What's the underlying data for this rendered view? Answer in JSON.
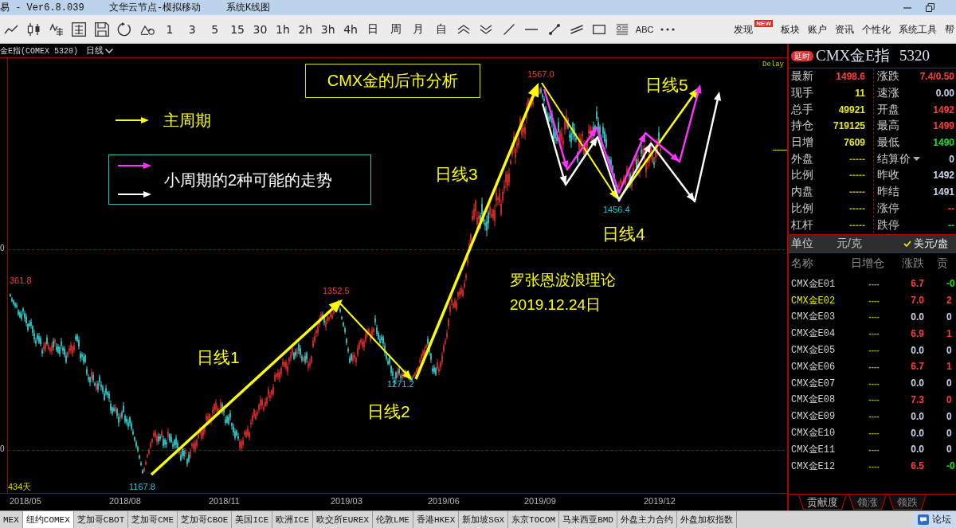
{
  "title_bar": {
    "app_version": "易 - Ver6.8.039",
    "server": "文华云节点-模拟移动",
    "window_title": "系统K线图"
  },
  "toolbar": {
    "periods": [
      "1",
      "3",
      "5",
      "15",
      "30",
      "1h",
      "2h",
      "3h",
      "4h",
      "日",
      "周",
      "月",
      "自"
    ],
    "text_tool": "ABC",
    "menu": [
      {
        "label": "发现",
        "badge": "NEW"
      },
      {
        "label": "板块"
      },
      {
        "label": "账户"
      },
      {
        "label": "资讯"
      },
      {
        "label": "个性化"
      },
      {
        "label": "系统工具"
      },
      {
        "label": "帮"
      }
    ]
  },
  "chart": {
    "symbol": "金E指(COMEX 5320)",
    "period": "日线",
    "delay": "Delay",
    "y_axis_labels": [
      "0",
      "0"
    ],
    "title": "CMX金的后市分析",
    "legend": {
      "main": {
        "label": "主周期",
        "color": "#ffff00"
      },
      "minor": {
        "label": "小周期的2种可能的走势",
        "arrows": [
          {
            "color": "#ff33ff"
          },
          {
            "color": "#ffffff"
          }
        ]
      }
    },
    "wave_labels": [
      "日线1",
      "日线2",
      "日线3",
      "日线4",
      "日线5"
    ],
    "notes": [
      "罗张恩波浪理论",
      "2019.12.24日"
    ],
    "price_labels": [
      {
        "text": "361.8",
        "kind": "high"
      },
      {
        "text": "1352.5",
        "kind": "high"
      },
      {
        "text": "1271.2",
        "kind": "low"
      },
      {
        "text": "1167.8",
        "kind": "low"
      },
      {
        "text": "1567.0",
        "kind": "high"
      },
      {
        "text": "1456.4",
        "kind": "low"
      }
    ],
    "day_count": "434天",
    "x_axis_labels": [
      "2018/05",
      "2018/08",
      "2018/11",
      "2019/03",
      "2019/06",
      "2019/09",
      "2019/12"
    ]
  },
  "quote_panel": {
    "badge": "延时",
    "name": "CMX金E指",
    "code": "5320",
    "left": [
      {
        "label": "最新",
        "value": "1498.6",
        "color": "#ff3b3b"
      },
      {
        "label": "现手",
        "value": "11",
        "color": "#e8e820"
      },
      {
        "label": "总手",
        "value": "49921",
        "color": "#e8e820"
      },
      {
        "label": "持仓",
        "value": "719125",
        "color": "#e8e820"
      },
      {
        "label": "日增",
        "value": "7609",
        "color": "#e8e820"
      },
      {
        "label": "外盘",
        "value": "-----",
        "color": "#b4b400"
      },
      {
        "label": "比例",
        "value": "-----",
        "color": "#b4b400"
      },
      {
        "label": "内盘",
        "value": "-----",
        "color": "#b4b400"
      },
      {
        "label": "比例",
        "value": "-----",
        "color": "#b4b400"
      },
      {
        "label": "杠杆",
        "value": "-----",
        "color": "#b4b400"
      }
    ],
    "right": [
      {
        "label": "涨跌",
        "value": "7.4/0.50",
        "color": "#ff3b3b",
        "kind": "field"
      },
      {
        "label": "速涨",
        "value": "0.00",
        "color": "#c8d4ec",
        "kind": "field"
      },
      {
        "label": "开盘",
        "value": "1492",
        "color": "#ff3b3b",
        "kind": "field"
      },
      {
        "label": "最高",
        "value": "1499",
        "color": "#ff3b3b",
        "kind": "field"
      },
      {
        "label": "最低",
        "value": "1490",
        "color": "#1ee01e",
        "kind": "field"
      },
      {
        "label": "结算价",
        "value": "0",
        "color": "#c8d4ec",
        "kind": "select"
      },
      {
        "label": "昨收",
        "value": "1492",
        "color": "#c8d4ec",
        "kind": "field"
      },
      {
        "label": "昨结",
        "value": "1491",
        "color": "#c8d4ec",
        "kind": "field"
      },
      {
        "label": "涨停",
        "value": "--",
        "color": "#ff3b3b",
        "kind": "field"
      },
      {
        "label": "跌停",
        "value": "--",
        "color": "#1ee01e",
        "kind": "field"
      }
    ],
    "unit_label": "单位",
    "units": [
      {
        "label": "元/克",
        "selected": false
      },
      {
        "label": "美元/盎",
        "selected": true
      }
    ],
    "list": {
      "columns": [
        "名称",
        "日增仓",
        "涨跌",
        "贡"
      ],
      "rows": [
        {
          "name": "CMX金E01",
          "selected": false,
          "daily_oi": "----",
          "change": {
            "text": "6.7",
            "color": "#ff3b3b"
          },
          "contribution": {
            "text": "-0",
            "color": "#1ee01e"
          }
        },
        {
          "name": "CMX金E02",
          "selected": true,
          "daily_oi": "----",
          "change": {
            "text": "7.0",
            "color": "#ff3b3b"
          },
          "contribution": {
            "text": "2",
            "color": "#ff3b3b"
          }
        },
        {
          "name": "CMX金E03",
          "selected": false,
          "daily_oi": "----",
          "change": {
            "text": "0.0",
            "color": "#c8d4ec"
          },
          "contribution": {
            "text": "0",
            "color": "#c8d4ec"
          }
        },
        {
          "name": "CMX金E04",
          "selected": false,
          "daily_oi": "----",
          "change": {
            "text": "6.9",
            "color": "#ff3b3b"
          },
          "contribution": {
            "text": "1",
            "color": "#ff3b3b"
          }
        },
        {
          "name": "CMX金E05",
          "selected": false,
          "daily_oi": "----",
          "change": {
            "text": "0.0",
            "color": "#c8d4ec"
          },
          "contribution": {
            "text": "0",
            "color": "#c8d4ec"
          }
        },
        {
          "name": "CMX金E06",
          "selected": false,
          "daily_oi": "----",
          "change": {
            "text": "6.7",
            "color": "#ff3b3b"
          },
          "contribution": {
            "text": "1",
            "color": "#ff3b3b"
          }
        },
        {
          "name": "CMX金E07",
          "selected": false,
          "daily_oi": "----",
          "change": {
            "text": "0.0",
            "color": "#c8d4ec"
          },
          "contribution": {
            "text": "0",
            "color": "#c8d4ec"
          }
        },
        {
          "name": "CMX金E08",
          "selected": false,
          "daily_oi": "----",
          "change": {
            "text": "7.3",
            "color": "#ff3b3b"
          },
          "contribution": {
            "text": "0",
            "color": "#ff3b3b"
          }
        },
        {
          "name": "CMX金E09",
          "selected": false,
          "daily_oi": "----",
          "change": {
            "text": "0.0",
            "color": "#c8d4ec"
          },
          "contribution": {
            "text": "0",
            "color": "#c8d4ec"
          }
        },
        {
          "name": "CMX金E10",
          "selected": false,
          "daily_oi": "----",
          "change": {
            "text": "0.0",
            "color": "#c8d4ec"
          },
          "contribution": {
            "text": "0",
            "color": "#c8d4ec"
          }
        },
        {
          "name": "CMX金E11",
          "selected": false,
          "daily_oi": "----",
          "change": {
            "text": "0.0",
            "color": "#c8d4ec"
          },
          "contribution": {
            "text": "0",
            "color": "#c8d4ec"
          }
        },
        {
          "name": "CMX金E12",
          "selected": false,
          "daily_oi": "----",
          "change": {
            "text": "6.5",
            "color": "#ff3b3b"
          },
          "contribution": {
            "text": "-0",
            "color": "#1ee01e"
          }
        }
      ]
    },
    "tabs": [
      {
        "label": "贡献度",
        "selected": true
      },
      {
        "label": "领涨",
        "selected": false
      },
      {
        "label": "领跌",
        "selected": false
      }
    ]
  },
  "exchange_tabs": [
    {
      "label": "MEX",
      "selected": false
    },
    {
      "label": "纽约COMEX",
      "selected": true
    },
    {
      "label": "芝加哥CBOT",
      "selected": false
    },
    {
      "label": "芝加哥CME",
      "selected": false
    },
    {
      "label": "芝加哥CBOE",
      "selected": false
    },
    {
      "label": "美国ICE",
      "selected": false
    },
    {
      "label": "欧洲ICE",
      "selected": false
    },
    {
      "label": "欧交所EUREX",
      "selected": false
    },
    {
      "label": "伦敦LME",
      "selected": false
    },
    {
      "label": "香港HKEX",
      "selected": false
    },
    {
      "label": "新加坡SGX",
      "selected": false
    },
    {
      "label": "东京TOCOM",
      "selected": false
    },
    {
      "label": "马来西亚BMD",
      "selected": false
    },
    {
      "label": "外盘主力合约",
      "selected": false
    },
    {
      "label": "外盘加权指数",
      "selected": false
    }
  ],
  "forum": "论坛"
}
